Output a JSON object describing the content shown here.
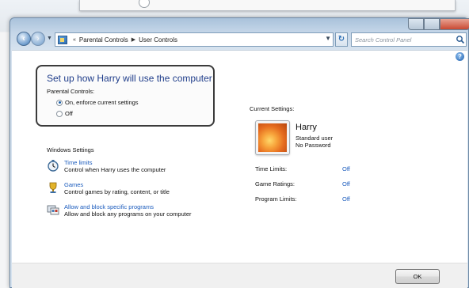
{
  "breadcrumb": {
    "root": "Parental Controls",
    "current": "User Controls"
  },
  "search": {
    "placeholder": "Search Control Panel"
  },
  "main": {
    "title": "Set up how Harry will use the computer",
    "parental_controls_label": "Parental Controls:",
    "options": [
      {
        "label": "On, enforce current settings",
        "selected": true
      },
      {
        "label": "Off",
        "selected": false
      }
    ],
    "windows_settings_label": "Windows Settings",
    "settings": [
      {
        "link": "Time limits",
        "desc": "Control when Harry uses the computer",
        "icon": "clock-icon"
      },
      {
        "link": "Games",
        "desc": "Control games by rating, content, or title",
        "icon": "trophy-icon"
      },
      {
        "link": "Allow and block specific programs",
        "desc": "Allow and block any programs on your computer",
        "icon": "programs-icon"
      }
    ]
  },
  "current": {
    "label": "Current Settings:",
    "user_name": "Harry",
    "user_type": "Standard user",
    "password": "No Password",
    "limits": [
      {
        "label": "Time Limits:",
        "value": "Off"
      },
      {
        "label": "Game Ratings:",
        "value": "Off"
      },
      {
        "label": "Program Limits:",
        "value": "Off"
      }
    ]
  },
  "footer": {
    "ok_label": "OK"
  },
  "colors": {
    "link": "#1a5bbd",
    "title": "#1f3d8a"
  }
}
